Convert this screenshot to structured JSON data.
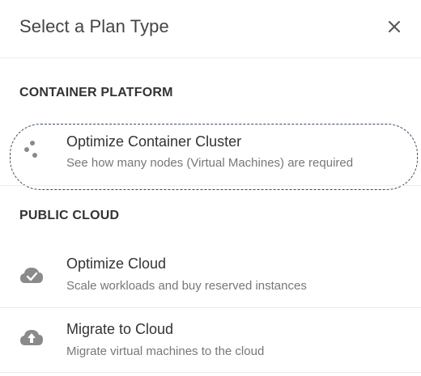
{
  "dialog": {
    "title": "Select a Plan Type",
    "close_icon": "close-icon"
  },
  "sections": [
    {
      "heading": "CONTAINER PLATFORM",
      "items": [
        {
          "name": "Optimize Container Cluster",
          "description": "See how many nodes (Virtual Machines) are required",
          "icon": "container-cluster-icon",
          "selected": true
        }
      ]
    },
    {
      "heading": "PUBLIC CLOUD",
      "items": [
        {
          "name": "Optimize Cloud",
          "description": "Scale workloads and buy reserved instances",
          "icon": "cloud-check-icon",
          "selected": false
        },
        {
          "name": "Migrate to Cloud",
          "description": "Migrate virtual machines to the cloud",
          "icon": "cloud-upload-icon",
          "selected": false
        }
      ]
    }
  ],
  "colors": {
    "icon_gray": "#8a8a8a",
    "selected_outline": "#3c4a5c"
  }
}
